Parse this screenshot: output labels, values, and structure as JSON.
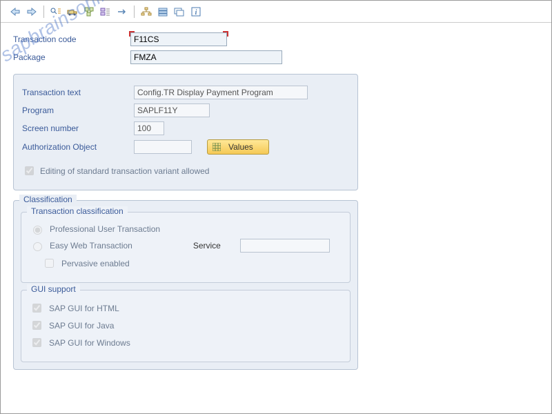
{
  "watermark": "sapbrainsonline.com",
  "header": {
    "labels": {
      "tcode": "Transaction code",
      "package": "Package"
    },
    "values": {
      "tcode": "F11CS",
      "package": "FMZA"
    }
  },
  "details": {
    "labels": {
      "text": "Transaction text",
      "program": "Program",
      "screen": "Screen number",
      "auth": "Authorization Object"
    },
    "values": {
      "text": "Config.TR Display Payment Program",
      "program": "SAPLF11Y",
      "screen": "100",
      "auth": ""
    },
    "values_btn": "Values",
    "edit_variant": "Editing of standard transaction variant allowed"
  },
  "classification": {
    "title": "Classification",
    "tc_group": {
      "title": "Transaction classification",
      "prof": "Professional User Transaction",
      "easy": "Easy Web Transaction",
      "service_label": "Service",
      "service_value": "",
      "pervasive": "Pervasive enabled"
    },
    "gui_group": {
      "title": "GUI support",
      "html": "SAP GUI for HTML",
      "java": "SAP GUI for Java",
      "win": "SAP GUI for Windows"
    }
  }
}
